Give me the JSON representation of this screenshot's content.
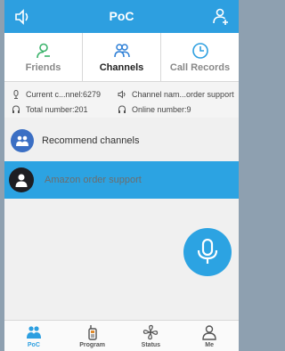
{
  "header": {
    "title": "PoC",
    "left_icon": "speaker-icon",
    "right_icon": "add-user-icon"
  },
  "tabs": [
    {
      "label": "Friends",
      "icon": "person-icon",
      "active": false
    },
    {
      "label": "Channels",
      "icon": "group-icon",
      "active": true
    },
    {
      "label": "Call Records",
      "icon": "clock-icon",
      "active": false
    }
  ],
  "info": {
    "current_channel": "Current c...nnel:6279",
    "channel_name": "Channel nam...order support",
    "total_number": "Total number:201",
    "online_number": "Online number:9"
  },
  "recommend": {
    "label": "Recommend channels"
  },
  "channels": [
    {
      "name": "Amazon order support"
    }
  ],
  "bottom_nav": [
    {
      "label": "PoC",
      "icon": "group-icon",
      "active": true
    },
    {
      "label": "Program",
      "icon": "walkie-talkie-icon",
      "active": false
    },
    {
      "label": "Status",
      "icon": "fan-icon",
      "active": false
    },
    {
      "label": "Me",
      "icon": "person-icon",
      "active": false
    }
  ],
  "colors": {
    "accent": "#2d9fe0",
    "green": "#3bb36b",
    "tab_blue": "#2d7fd6",
    "orange": "#e08a2b"
  }
}
